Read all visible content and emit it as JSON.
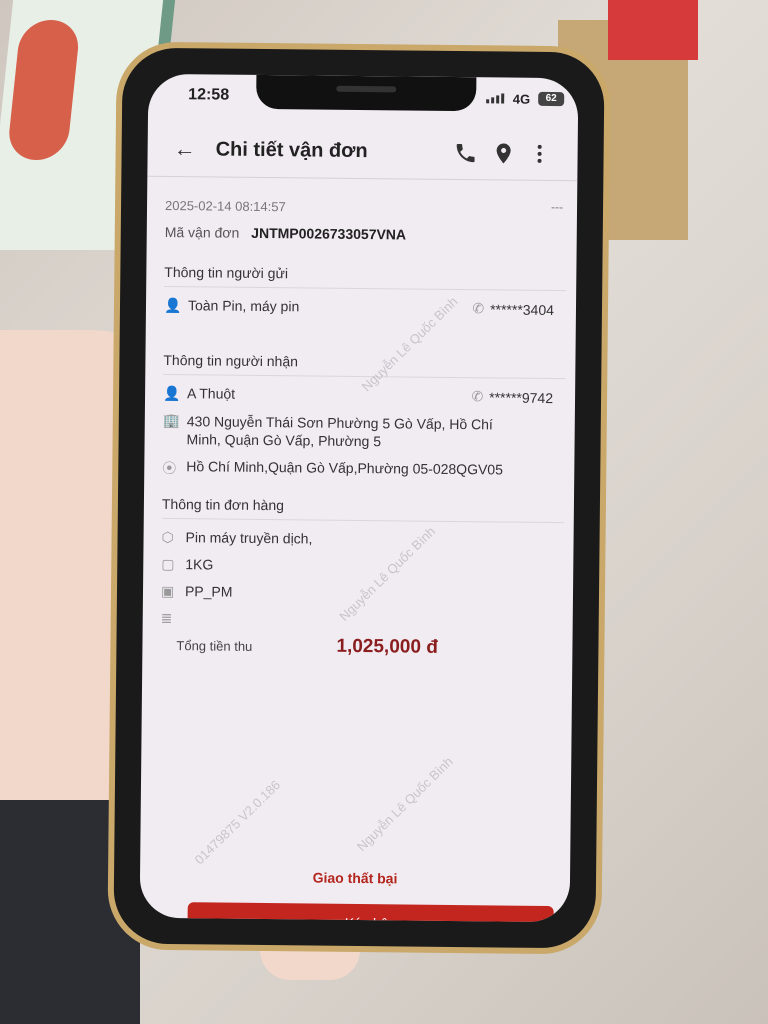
{
  "status": {
    "time": "12:58",
    "network": "4G",
    "battery": "62"
  },
  "appbar": {
    "back_icon": "back-arrow-icon",
    "title": "Chi tiết vận đơn",
    "icons": [
      "phone-icon",
      "location-pin-icon",
      "more-vert-icon"
    ]
  },
  "header": {
    "timestamp": "2025-02-14 08:14:57",
    "more": "---",
    "code_label": "Mã vận đơn",
    "code_value": "JNTMP0026733057VNA"
  },
  "sender": {
    "section_title": "Thông tin người gửi",
    "name": "Toàn Pin, máy pin",
    "phone": "******3404"
  },
  "receiver": {
    "section_title": "Thông tin người nhận",
    "name": "A Thuột",
    "phone": "******9742",
    "address": "430 Nguyễn Thái Sơn Phường 5 Gò Vấp, Hồ Chí Minh, Quận Gò Vấp, Phường 5",
    "area": "Hồ Chí Minh,Quận Gò Vấp,Phường 05-028QGV05"
  },
  "order": {
    "section_title": "Thông tin đơn hàng",
    "item": "Pin máy truyền dịch,",
    "weight": "1KG",
    "payment": "PP_PM",
    "note": ""
  },
  "total": {
    "label": "Tổng tiền thu",
    "amount": "1,025,000 đ"
  },
  "actions": {
    "fail_label": "Giao thất bại",
    "confirm_label": "Ký nhận"
  },
  "watermark": {
    "name": "Nguyễn Lê Quốc Bình",
    "code": "01479875 V2.0.186"
  },
  "colors": {
    "accent": "#c3261f",
    "amount": "#8a1d1d",
    "screen_bg": "#f1ebf2"
  }
}
